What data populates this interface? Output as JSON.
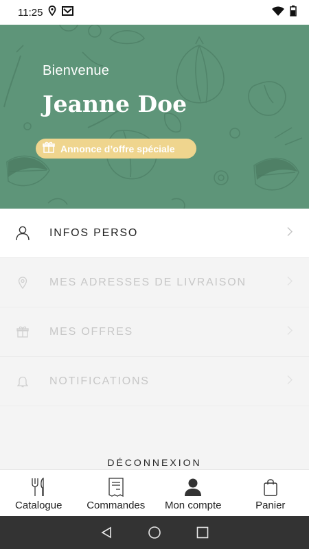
{
  "status_bar": {
    "time": "11:25",
    "icons": [
      "location-icon",
      "mail-icon",
      "wifi-icon",
      "battery-icon"
    ]
  },
  "hero": {
    "greeting": "Bienvenue",
    "user_name": "Jeanne Doe",
    "offer_label": "Annonce d’offre spéciale",
    "bg_color": "#5e9579",
    "pill_color": "#efd58e"
  },
  "menu": {
    "items": [
      {
        "label": "INFOS PERSO",
        "icon": "user-icon",
        "enabled": true
      },
      {
        "label": "MES ADRESSES DE LIVRAISON",
        "icon": "location-pin-icon",
        "enabled": false
      },
      {
        "label": "MES OFFRES",
        "icon": "gift-icon",
        "enabled": false
      },
      {
        "label": "NOTIFICATIONS",
        "icon": "bell-icon",
        "enabled": false
      }
    ]
  },
  "logout_label": "DÉCONNEXION",
  "bottom_nav": {
    "items": [
      {
        "label": "Catalogue",
        "icon": "cutlery-icon",
        "active": false
      },
      {
        "label": "Commandes",
        "icon": "receipt-icon",
        "active": false
      },
      {
        "label": "Mon compte",
        "icon": "account-icon",
        "active": true
      },
      {
        "label": "Panier",
        "icon": "bag-icon",
        "active": false
      }
    ]
  },
  "system_nav": [
    "back-icon",
    "home-icon",
    "recents-icon"
  ]
}
